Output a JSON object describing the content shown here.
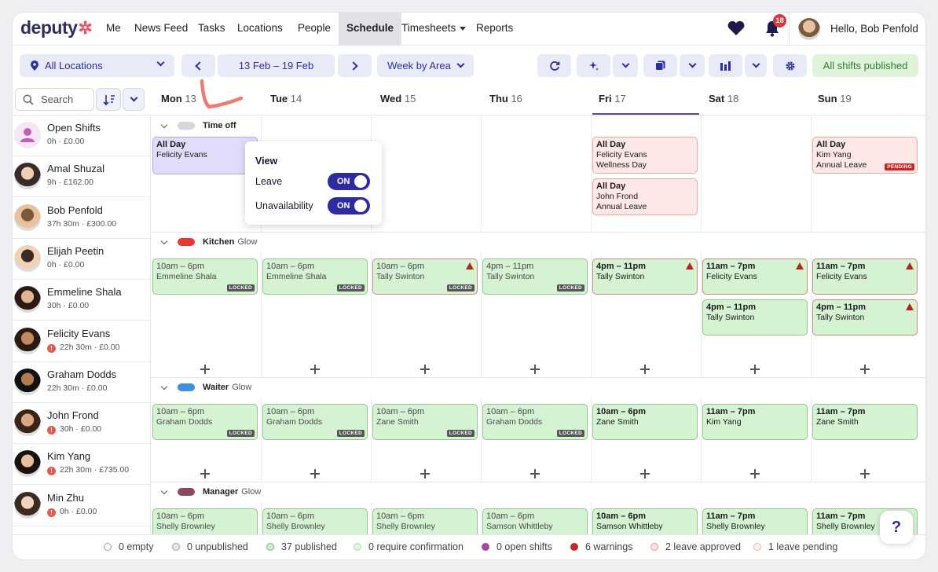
{
  "nav": {
    "brand": "deputy",
    "items": [
      "Me",
      "News Feed",
      "Tasks",
      "Locations",
      "People",
      "Schedule",
      "Timesheets",
      "Reports"
    ],
    "notifications": "18",
    "greeting": "Hello, Bob Penfold"
  },
  "toolbar": {
    "location": "All Locations",
    "date_range": "13 Feb – 19 Feb",
    "view": "Week by Area",
    "status": "All shifts published"
  },
  "search": {
    "label": "Search"
  },
  "days": [
    {
      "name": "Mon",
      "num": "13"
    },
    {
      "name": "Tue",
      "num": "14"
    },
    {
      "name": "Wed",
      "num": "15"
    },
    {
      "name": "Thu",
      "num": "16"
    },
    {
      "name": "Fri",
      "num": "17"
    },
    {
      "name": "Sat",
      "num": "18"
    },
    {
      "name": "Sun",
      "num": "19"
    }
  ],
  "employees": [
    {
      "name": "Open Shifts",
      "meta": "0h · £0.00",
      "warn": false
    },
    {
      "name": "Amal Shuzal",
      "meta": "9h · £162.00",
      "warn": false
    },
    {
      "name": "Bob Penfold",
      "meta": "37h 30m · £300.00",
      "warn": false
    },
    {
      "name": "Elijah Peetin",
      "meta": "0h · £0.00",
      "warn": false
    },
    {
      "name": "Emmeline Shala",
      "meta": "30h · £0.00",
      "warn": false
    },
    {
      "name": "Felicity Evans",
      "meta": "22h 30m · £0.00",
      "warn": true
    },
    {
      "name": "Graham Dodds",
      "meta": "22h 30m · £0.00",
      "warn": false
    },
    {
      "name": "John Frond",
      "meta": "30h · £0.00",
      "warn": true
    },
    {
      "name": "Kim Yang",
      "meta": "22h 30m · £735.00",
      "warn": true
    },
    {
      "name": "Min Zhu",
      "meta": "0h · £0.00",
      "warn": true
    }
  ],
  "areas": {
    "timeoff": {
      "name": "Time off"
    },
    "kitchen": {
      "name": "Kitchen",
      "loc": "Glow",
      "color": "#e53935"
    },
    "waiter": {
      "name": "Waiter",
      "loc": "Glow",
      "color": "#3e8fe0"
    },
    "manager": {
      "name": "Manager",
      "loc": "Glow",
      "color": "#8a4a5e"
    }
  },
  "leave": [
    {
      "day": 0,
      "row": 0,
      "title": "All Day",
      "name": "Felicity Evans",
      "type": "",
      "style": "purple"
    },
    {
      "day": 4,
      "row": 0,
      "title": "All Day",
      "name": "Felicity Evans",
      "type": "Wellness Day",
      "style": "red"
    },
    {
      "day": 4,
      "row": 1,
      "title": "All Day",
      "name": "John Frond",
      "type": "Annual Leave",
      "style": "red"
    },
    {
      "day": 6,
      "row": 0,
      "title": "All Day",
      "name": "Kim Yang",
      "type": "Annual Leave",
      "style": "red",
      "badge": "PENDING"
    }
  ],
  "shifts": {
    "kitchen": [
      {
        "day": 0,
        "row": 0,
        "time": "10am – 6pm",
        "name": "Emmeline Shala",
        "locked": true,
        "warn": false
      },
      {
        "day": 1,
        "row": 0,
        "time": "10am – 6pm",
        "name": "Emmeline Shala",
        "locked": true,
        "warn": false
      },
      {
        "day": 2,
        "row": 0,
        "time": "10am – 6pm",
        "name": "Tally Swinton",
        "locked": true,
        "warn": true
      },
      {
        "day": 3,
        "row": 0,
        "time": "4pm – 11pm",
        "name": "Tally Swinton",
        "locked": true,
        "warn": false
      },
      {
        "day": 4,
        "row": 0,
        "time": "4pm – 11pm",
        "name": "Tally Swinton",
        "locked": false,
        "warn": true
      },
      {
        "day": 5,
        "row": 0,
        "time": "11am – 7pm",
        "name": "Felicity Evans",
        "locked": false,
        "warn": true
      },
      {
        "day": 6,
        "row": 0,
        "time": "11am – 7pm",
        "name": "Felicity Evans",
        "locked": false,
        "warn": true
      },
      {
        "day": 5,
        "row": 1,
        "time": "4pm – 11pm",
        "name": "Tally Swinton",
        "locked": false,
        "warn": false
      },
      {
        "day": 6,
        "row": 1,
        "time": "4pm – 11pm",
        "name": "Tally Swinton",
        "locked": false,
        "warn": true
      }
    ],
    "waiter": [
      {
        "day": 0,
        "row": 0,
        "time": "10am – 6pm",
        "name": "Graham Dodds",
        "locked": true,
        "warn": false
      },
      {
        "day": 1,
        "row": 0,
        "time": "10am – 6pm",
        "name": "Graham Dodds",
        "locked": true,
        "warn": false
      },
      {
        "day": 2,
        "row": 0,
        "time": "10am – 6pm",
        "name": "Zane Smith",
        "locked": true,
        "warn": false
      },
      {
        "day": 3,
        "row": 0,
        "time": "10am – 6pm",
        "name": "Graham Dodds",
        "locked": true,
        "warn": false
      },
      {
        "day": 4,
        "row": 0,
        "time": "10am – 6pm",
        "name": "Zane Smith",
        "locked": false,
        "warn": false
      },
      {
        "day": 5,
        "row": 0,
        "time": "11am – 7pm",
        "name": "Kim Yang",
        "locked": false,
        "warn": false
      },
      {
        "day": 6,
        "row": 0,
        "time": "11am – 7pm",
        "name": "Zane Smith",
        "locked": false,
        "warn": false
      }
    ],
    "manager": [
      {
        "day": 0,
        "row": 0,
        "time": "10am – 6pm",
        "name": "Shelly Brownley",
        "locked": true,
        "warn": false
      },
      {
        "day": 1,
        "row": 0,
        "time": "10am – 6pm",
        "name": "Shelly Brownley",
        "locked": true,
        "warn": false
      },
      {
        "day": 2,
        "row": 0,
        "time": "10am – 6pm",
        "name": "Shelly Brownley",
        "locked": true,
        "warn": false
      },
      {
        "day": 3,
        "row": 0,
        "time": "10am – 6pm",
        "name": "Samson Whittleby",
        "locked": true,
        "warn": false
      },
      {
        "day": 4,
        "row": 0,
        "time": "10am – 6pm",
        "name": "Samson Whittleby",
        "locked": false,
        "warn": false
      },
      {
        "day": 5,
        "row": 0,
        "time": "11am – 7pm",
        "name": "Shelly Brownley",
        "locked": false,
        "warn": false
      },
      {
        "day": 6,
        "row": 0,
        "time": "11am – 7pm",
        "name": "Shelly Brownley",
        "locked": false,
        "warn": false
      }
    ]
  },
  "labels": {
    "locked": "LOCKED"
  },
  "popover": {
    "title": "View",
    "leave": "Leave",
    "unavailability": "Unavailability",
    "on": "ON"
  },
  "footer": [
    {
      "label": "0 empty",
      "color": "#ffffff",
      "border": "#999"
    },
    {
      "label": "0 unpublished",
      "color": "#e8e8e8",
      "border": "#999"
    },
    {
      "label": "37 published",
      "color": "#cdeec9",
      "border": "#6fb86a"
    },
    {
      "label": "0 require confirmation",
      "color": "#e3f5df",
      "border": "#a9d8a4"
    },
    {
      "label": "0 open shifts",
      "color": "#a04aa0",
      "border": "#a04aa0"
    },
    {
      "label": "6 warnings",
      "color": "#c62828",
      "border": "#c62828"
    },
    {
      "label": "2 leave approved",
      "color": "#fde4e2",
      "border": "#e09a94"
    },
    {
      "label": "1 leave pending",
      "color": "#fdf0ee",
      "border": "#eab9b3"
    }
  ],
  "help": "?"
}
